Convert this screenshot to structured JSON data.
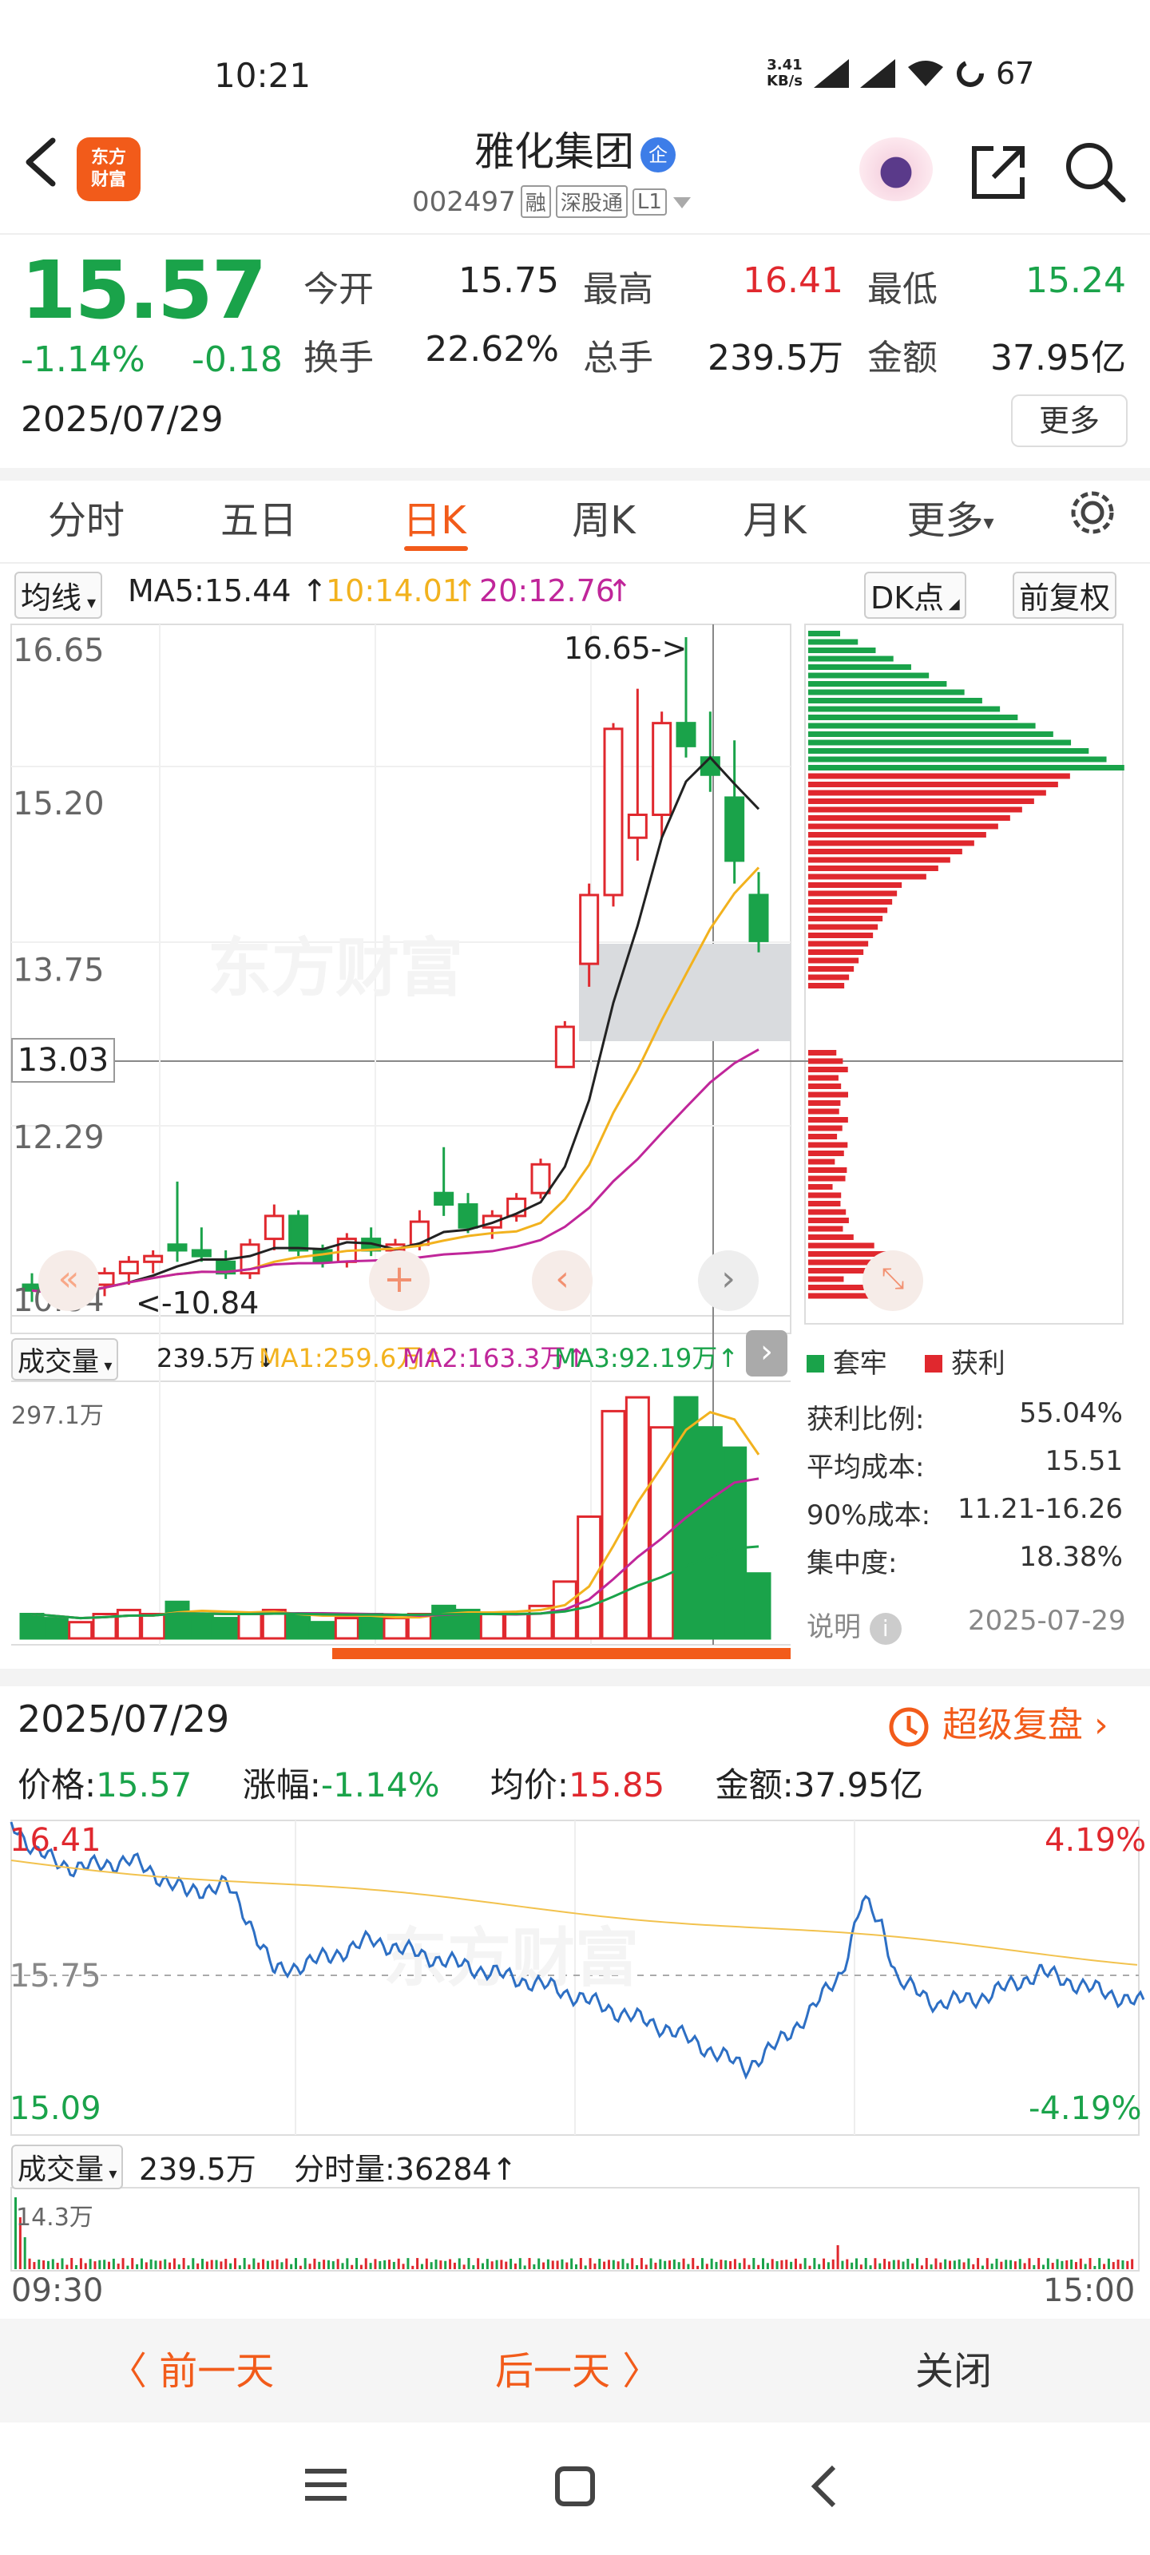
{
  "status_bar": {
    "time": "10:21",
    "speed_value": "3.41",
    "speed_unit": "KB/s",
    "battery": "67"
  },
  "header": {
    "title": "雅化集团",
    "badge": "企",
    "code": "002497",
    "tags": [
      "融",
      "深股通",
      "L1"
    ]
  },
  "quote": {
    "price": "15.57",
    "change_pct": "-1.14%",
    "change": "-0.18",
    "date": "2025/07/29",
    "rows": [
      [
        {
          "label": "今开",
          "value": "15.75",
          "color": "#222222"
        },
        {
          "label": "最高",
          "value": "16.41",
          "color": "#e0282e"
        },
        {
          "label": "最低",
          "value": "15.24",
          "color": "#1aa34a"
        }
      ],
      [
        {
          "label": "换手",
          "value": "22.62%",
          "color": "#222222"
        },
        {
          "label": "总手",
          "value": "239.5万",
          "color": "#222222"
        },
        {
          "label": "金额",
          "value": "37.95亿",
          "color": "#222222"
        }
      ]
    ],
    "more": "更多"
  },
  "tabs": [
    "分时",
    "五日",
    "日K",
    "周K",
    "月K",
    "更多"
  ],
  "active_tab": "日K",
  "indicators": {
    "selector": "均线",
    "ma5": "MA5:15.44",
    "ma10": "10:14.01",
    "ma20": "20:12.76",
    "dk": "DK点",
    "fq": "前复权"
  },
  "kline": {
    "y_labels": [
      "16.65",
      "15.20",
      "13.75",
      "12.29",
      "10.84"
    ],
    "crosshair_price": "13.03",
    "high_marker": "16.65->",
    "low_marker": "<-10.84",
    "watermark": "东方财富"
  },
  "volume": {
    "selector": "成交量",
    "vol": "239.5万↓",
    "ma1": "MA1:259.6万↑",
    "ma2": "MA2:163.3万↑",
    "ma3": "MA3:92.19万↑",
    "max": "297.1万"
  },
  "chip": {
    "legend_tao": "套牢",
    "legend_huo": "获利",
    "stats": [
      {
        "label": "获利比例:",
        "value": "55.04%"
      },
      {
        "label": "平均成本:",
        "value": "15.51"
      },
      {
        "label": "90%成本:",
        "value": "11.21-16.26"
      },
      {
        "label": "集中度:",
        "value": "18.38%"
      }
    ],
    "note": "说明",
    "note_date": "2025-07-29"
  },
  "intraday": {
    "date": "2025/07/29",
    "replay": "超级复盘",
    "price_label": "价格:",
    "price": "15.57",
    "pct_label": "涨幅:",
    "pct": "-1.14%",
    "avg_label": "均价:",
    "avg": "15.85",
    "amt_label": "金额:",
    "amt": "37.95亿",
    "y_top": "16.41",
    "y_mid": "15.75",
    "y_bot": "15.09",
    "pct_top": "4.19%",
    "pct_bot": "-4.19%",
    "vol_selector": "成交量",
    "vol": "239.5万",
    "tick_vol": "分时量:36284↑",
    "vol_max": "14.3万",
    "t_start": "09:30",
    "t_end": "15:00"
  },
  "footer": {
    "prev": "〈 前一天",
    "next": "后一天 〉",
    "close": "关闭"
  },
  "colors": {
    "up": "#e0282e",
    "down": "#1aa34a",
    "accent": "#f25b1a",
    "ma5": "#222222",
    "ma10": "#f2b21e",
    "ma20": "#c0269a"
  },
  "chart_data": {
    "type": "candlestick",
    "candles": [
      {
        "o": 11.0,
        "h": 11.1,
        "l": 10.85,
        "c": 10.95
      },
      {
        "o": 10.95,
        "h": 11.05,
        "l": 10.84,
        "c": 10.9
      },
      {
        "o": 10.9,
        "h": 11.0,
        "l": 10.85,
        "c": 10.95
      },
      {
        "o": 11.0,
        "h": 11.15,
        "l": 10.9,
        "c": 11.1
      },
      {
        "o": 11.1,
        "h": 11.25,
        "l": 11.0,
        "c": 11.2
      },
      {
        "o": 11.2,
        "h": 11.3,
        "l": 11.1,
        "c": 11.25
      },
      {
        "o": 11.35,
        "h": 11.9,
        "l": 11.2,
        "c": 11.3
      },
      {
        "o": 11.3,
        "h": 11.5,
        "l": 11.2,
        "c": 11.25
      },
      {
        "o": 11.2,
        "h": 11.3,
        "l": 11.05,
        "c": 11.1
      },
      {
        "o": 11.1,
        "h": 11.4,
        "l": 11.05,
        "c": 11.35
      },
      {
        "o": 11.4,
        "h": 11.7,
        "l": 11.3,
        "c": 11.6
      },
      {
        "o": 11.6,
        "h": 11.65,
        "l": 11.25,
        "c": 11.3
      },
      {
        "o": 11.3,
        "h": 11.35,
        "l": 11.15,
        "c": 11.2
      },
      {
        "o": 11.2,
        "h": 11.45,
        "l": 11.15,
        "c": 11.4
      },
      {
        "o": 11.4,
        "h": 11.5,
        "l": 11.25,
        "c": 11.3
      },
      {
        "o": 11.3,
        "h": 11.4,
        "l": 11.2,
        "c": 11.35
      },
      {
        "o": 11.35,
        "h": 11.65,
        "l": 11.3,
        "c": 11.55
      },
      {
        "o": 11.8,
        "h": 12.2,
        "l": 11.6,
        "c": 11.7
      },
      {
        "o": 11.7,
        "h": 11.8,
        "l": 11.45,
        "c": 11.5
      },
      {
        "o": 11.5,
        "h": 11.65,
        "l": 11.4,
        "c": 11.6
      },
      {
        "o": 11.6,
        "h": 11.8,
        "l": 11.55,
        "c": 11.75
      },
      {
        "o": 11.8,
        "h": 12.1,
        "l": 11.75,
        "c": 12.05
      },
      {
        "o": 12.9,
        "h": 13.3,
        "l": 12.9,
        "c": 13.25
      },
      {
        "o": 13.8,
        "h": 14.5,
        "l": 13.6,
        "c": 14.4
      },
      {
        "o": 14.4,
        "h": 15.9,
        "l": 14.3,
        "c": 15.85
      },
      {
        "o": 14.9,
        "h": 16.2,
        "l": 14.7,
        "c": 15.1
      },
      {
        "o": 15.1,
        "h": 16.0,
        "l": 14.9,
        "c": 15.9
      },
      {
        "o": 15.9,
        "h": 16.65,
        "l": 15.6,
        "c": 15.7
      },
      {
        "o": 15.6,
        "h": 16.0,
        "l": 15.3,
        "c": 15.45
      },
      {
        "o": 15.25,
        "h": 15.75,
        "l": 14.5,
        "c": 14.7
      },
      {
        "o": 14.4,
        "h": 14.6,
        "l": 13.9,
        "c": 14.0
      }
    ],
    "ylim": [
      10.84,
      16.65
    ],
    "volume": [
      0.3,
      0.25,
      0.2,
      0.3,
      0.35,
      0.3,
      0.45,
      0.3,
      0.25,
      0.3,
      0.35,
      0.3,
      0.2,
      0.25,
      0.3,
      0.25,
      0.3,
      0.4,
      0.35,
      0.3,
      0.3,
      0.4,
      0.7,
      1.5,
      2.8,
      2.97,
      2.6,
      2.97,
      2.6,
      2.35,
      0.8
    ]
  }
}
